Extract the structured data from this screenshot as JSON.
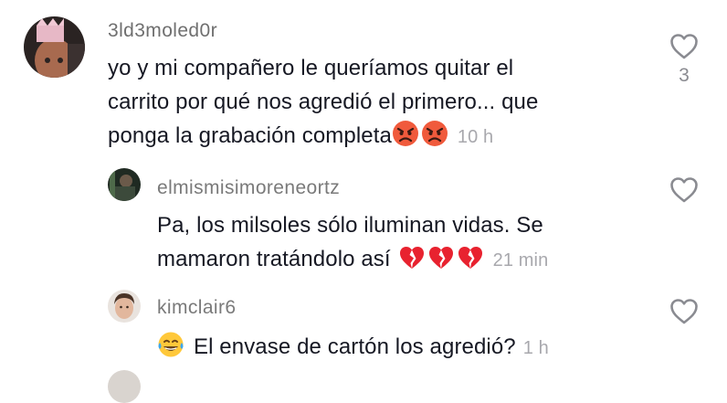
{
  "comments": [
    {
      "username": "3ld3moled0r",
      "text_lines": [
        "yo y mi compañero le queríamos quitar el",
        "carrito por qué nos agredió el primero... que",
        "ponga la grabación completa"
      ],
      "emojis": [
        "angry-face",
        "angry-face"
      ],
      "time": "10 h",
      "likes": "3"
    },
    {
      "username": "elmismisimoreneortz",
      "text_lines": [
        "Pa, los milsoles sólo iluminan vidas. Se",
        "mamaron tratándolo así"
      ],
      "emojis": [
        "broken-heart",
        "broken-heart",
        "broken-heart"
      ],
      "time": "21 min"
    },
    {
      "username": "kimclair6",
      "emoji_prefix": "face-with-tears-of-joy",
      "text_lines": [
        "El envase de cartón los agredió?"
      ],
      "time": "1 h"
    }
  ],
  "colors": {
    "text": "#161823",
    "username": "#7a7a7a",
    "meta": "#a8a8ad",
    "icon": "#8a8b91",
    "angry": "#f05a3c",
    "broken_heart": "#e8222f",
    "laugh": "#ffc83a"
  }
}
